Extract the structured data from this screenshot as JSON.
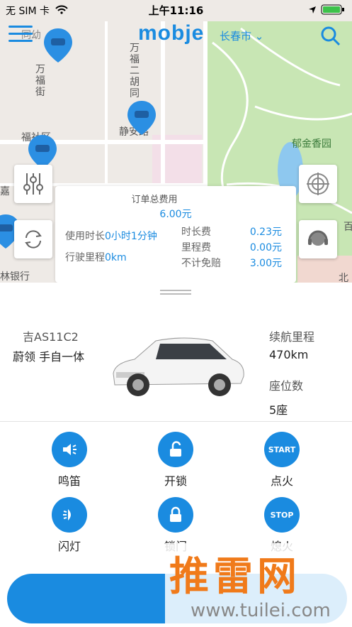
{
  "status_bar": {
    "carrier": "无 SIM 卡",
    "time": "上午11:16"
  },
  "header": {
    "logo": "mobje",
    "city": "长春市"
  },
  "map": {
    "labels": {
      "street1": "万\n福\n街",
      "street2": "万\n福\n二\n胡\n同",
      "community": "福社区",
      "jing": "静安路",
      "park": "郁金香园",
      "bank": "林银行",
      "jia": "嘉",
      "bei": "北",
      "bai": "百",
      "road": "同幼"
    }
  },
  "fee": {
    "title": "订单总费用",
    "total": "6.00元",
    "use_time_label": "使用时长",
    "use_time_value": "0小时1分钟",
    "distance_label": "行驶里程",
    "distance_value": "0km",
    "items": [
      {
        "label": "时长费",
        "value": "0.23元"
      },
      {
        "label": "里程费",
        "value": "0.00元"
      },
      {
        "label": "不计免赔",
        "value": "3.00元"
      }
    ]
  },
  "car": {
    "plate": "吉AS11C2",
    "model": "蔚领 手自一体",
    "range_label": "续航里程",
    "range_value": "470km",
    "seats_label": "座位数",
    "seats_value": "5座"
  },
  "controls": [
    {
      "label": "鸣笛",
      "icon": "horn-icon"
    },
    {
      "label": "开锁",
      "icon": "unlock-icon"
    },
    {
      "label": "点火",
      "icon": "start-icon",
      "text": "START"
    },
    {
      "label": "闪灯",
      "icon": "flash-icon"
    },
    {
      "label": "锁门",
      "icon": "lock-icon"
    },
    {
      "label": "熄火",
      "icon": "stop-icon",
      "text": "STOP"
    }
  ],
  "watermark": {
    "big": "推雷网",
    "small": "www.tuilei.com"
  },
  "colors": {
    "accent": "#1a8be0",
    "park": "#c8e6b4",
    "map_bg": "#eeeae6"
  }
}
